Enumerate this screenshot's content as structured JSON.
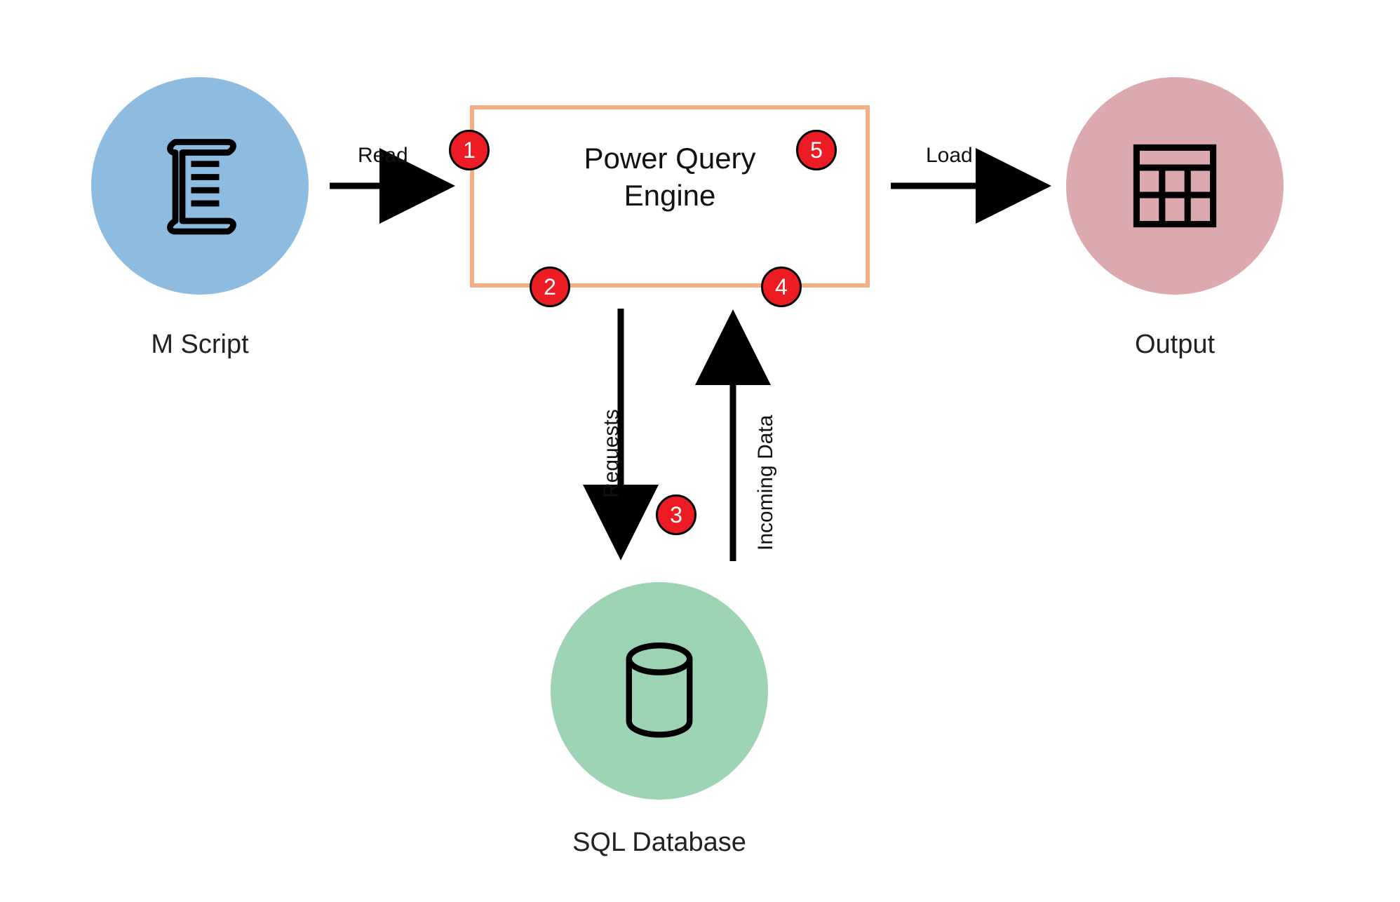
{
  "nodes": {
    "m_script": {
      "label": "M Script",
      "color": "#8dbce0"
    },
    "engine": {
      "label": "Power Query\nEngine",
      "border": "#f3b183"
    },
    "sql_db": {
      "label": "SQL Database",
      "color": "#9bd3b3"
    },
    "output": {
      "label": "Output",
      "color": "#dca9ae"
    }
  },
  "edges": {
    "read": {
      "label": "Read"
    },
    "load": {
      "label": "Load"
    },
    "requests": {
      "label": "Requests"
    },
    "incoming": {
      "label": "Incoming Data"
    }
  },
  "badges": {
    "b1": "1",
    "b2": "2",
    "b3": "3",
    "b4": "4",
    "b5": "5"
  }
}
